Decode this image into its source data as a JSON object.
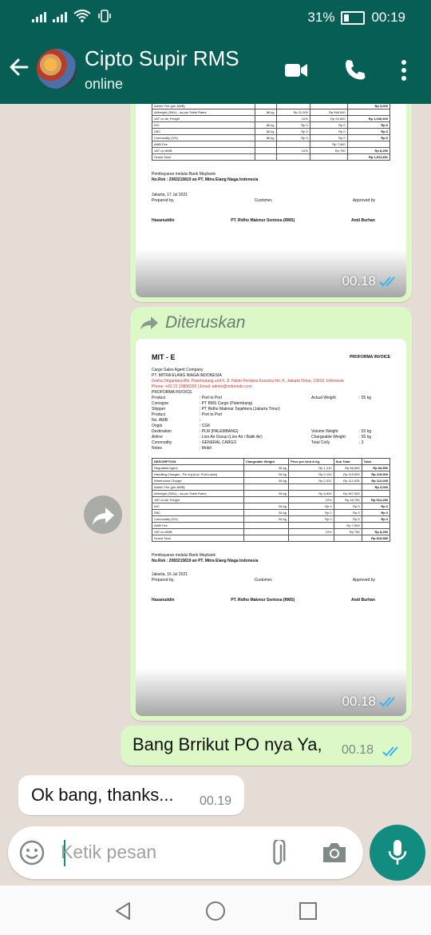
{
  "status_bar": {
    "battery": "31%",
    "time": "00:19"
  },
  "header": {
    "contact_name": "Cipto Supir RMS",
    "status": "online"
  },
  "messages": {
    "first_image_time": "00.18",
    "forwarded_label": "Diteruskan",
    "doc": {
      "brand": "MIT - E",
      "doc_title": "PROFORMA INVOICE",
      "company_line1": "Cargo Sales Agent Company",
      "company_line2": "PT. MITRA ELANG NIAGA INDONESIA",
      "address": "Graha Dirgantara Blk. Pasirmalang unit F, Jl. Halim Perdana Kusuma No. K, Jakarta Timur, 13610, Indonesia",
      "phone": "Phone: +62 21 29808200 | Email: admin@mitreinde.com",
      "section": "PROFORMA INVOICE",
      "fields": [
        [
          "Product",
          ": Port to Port",
          "Actual Weight",
          ": 55 kg"
        ],
        [
          "Consigne",
          ": PT BMS Cargo (Palembang)",
          "",
          ""
        ],
        [
          "Shipper",
          ": PT Ridho Makmur Sejahtera (Jakarta Timur)",
          "",
          ""
        ],
        [
          "Product",
          ": Port to Port",
          "",
          ""
        ],
        [
          "No. AWB",
          ":",
          "",
          ""
        ],
        [
          "Origin",
          ": CGK",
          "",
          ""
        ],
        [
          "Destination",
          ": PLM (PALEMBANG)",
          "Volume Weight",
          ": 53 kg"
        ],
        [
          "Airline",
          ": Lion Air Group (Lion Air / Batik Air)",
          "Chargeable Weight",
          ": 55 kg"
        ],
        [
          "Commodity",
          ": GENERAL CARGO",
          "Total Colly",
          ": 3"
        ],
        [
          "Notes",
          ": Mobil",
          "",
          ""
        ]
      ],
      "table_headers": [
        "DESCRIPTION",
        "Chargeable Weight",
        "Price per Unit & Kg",
        "Sub Total",
        "Total"
      ],
      "table_rows": [
        [
          "Regulated Agent",
          "55 kg",
          "Rp 1,210",
          "Rp 66,550",
          "Rp 66,550"
        ],
        [
          "Handling Charges - Per Kg (Incl. Print Label)",
          "55 kg",
          "Rp 2,100",
          "Rp 115,500",
          "Rp 115,500"
        ],
        [
          "Warehouse Charge",
          "55 kg",
          "Rp 2,037",
          "Rp 112,035",
          "Rp 112,035"
        ],
        [
          "Admin Fee (per AWB)",
          "",
          "",
          "",
          "Rp 3,000"
        ],
        [
          "Airfreight (SMU) - as per Table Rates",
          "55 kg",
          "Rp 8,500",
          "Rp 467,500",
          ""
        ],
        [
          "VAT on Air Freight",
          "",
          "10%",
          "Rp 46,750",
          "Rp 514,250"
        ],
        [
          "IHC",
          "55 kg",
          "Rp 0",
          "Rp 0",
          "Rp 0"
        ],
        [
          "ZBC",
          "55 kg",
          "Rp 0",
          "Rp 0",
          "Rp 0"
        ],
        [
          "Commodity (0%)",
          "55 kg",
          "Rp 0",
          "Rp 0",
          "Rp 0"
        ],
        [
          "AWB Fee",
          "",
          "",
          "Rp 7,500",
          ""
        ],
        [
          "VAT on AWB",
          "",
          "10%",
          "Rp 750",
          "Rp 8,250"
        ],
        [
          "Grand Total",
          "",
          "",
          "",
          "Rp 819,585"
        ]
      ],
      "payment_line1": "Pembayaran melalui Bank Maybank",
      "payment_line2": "No.Rek : 2083215819 an PT. Mitra Elang Niaga Indonesia",
      "date": "Jakarta, 16 Jul 2021",
      "prepared_by": "Prepared by,",
      "customer": "Customer,",
      "approved_by": "Approved by",
      "sign1": "Hasanuddin",
      "sign2": "PT. Ridho Makmur Sentosa (RMS)",
      "sign3": "Andi Burhan"
    },
    "top_doc": {
      "rows": [
        [
          "Admin Fee (per AWB)",
          "",
          "",
          "",
          "Rp 3,000"
        ],
        [
          "Airfreight (SMU) - as per Table Rates",
          "86 kg",
          "Rp 11,000",
          "Rp 946,000",
          ""
        ],
        [
          "VAT on Air Freight",
          "",
          "10%",
          "Rp 94,600",
          "Rp 1,040,600"
        ],
        [
          "IHC",
          "86 kg",
          "Rp 0",
          "Rp 0",
          "Rp 0"
        ],
        [
          "ZBC",
          "86 kg",
          "Rp 0",
          "Rp 0",
          "Rp 0"
        ],
        [
          "Commodity (0%)",
          "86 kg",
          "Rp 0",
          "Rp 0",
          "Rp 0"
        ],
        [
          "AWB Fee",
          "",
          "",
          "Rp 7,500",
          ""
        ],
        [
          "VAT on AWB",
          "",
          "10%",
          "Rp 750",
          "Rp 8,250"
        ],
        [
          "Grand Total",
          "",
          "",
          "",
          "Rp 1,511,691"
        ]
      ],
      "payment_line1": "Pembayaran melalui Bank Maybank",
      "payment_line2": "No.Rek : 2083215819 an PT. Mitra Elang Niaga Indonesia",
      "date": "Jakarta, 17 Jul 2021",
      "prepared_by": "Prepared by,",
      "customer": "Customer,",
      "approved_by": "Approved by",
      "sign1": "Hasanuddin",
      "sign2": "PT. Ridho Makmur Sentosa (RMS)",
      "sign3": "Andi Burhan"
    },
    "second_image_time": "00.18",
    "text_out": "Bang Brrikut PO nya Ya,",
    "text_out_time": "00.18",
    "text_in": "Ok bang, thanks...",
    "text_in_time": "00.19"
  },
  "composer": {
    "placeholder": "Ketik pesan"
  },
  "colors": {
    "primary": "#075e54",
    "accent": "#128c7e",
    "outgoing": "#dcf8c6",
    "tick_blue": "#34b7f1"
  }
}
